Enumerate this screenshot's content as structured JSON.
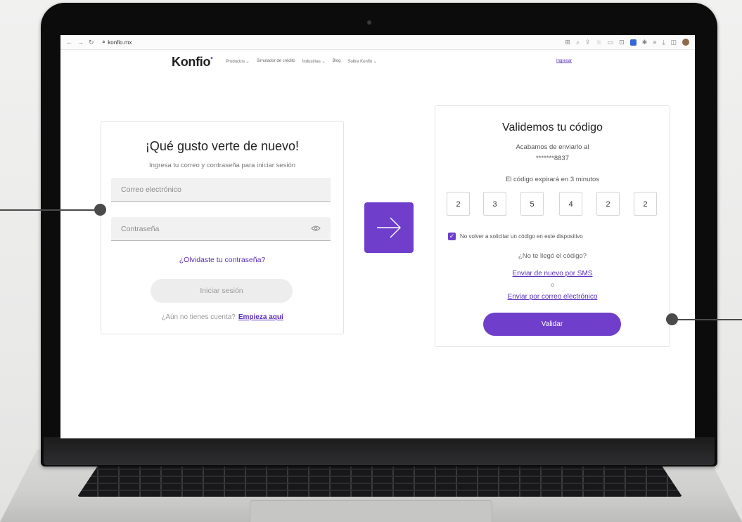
{
  "browser": {
    "url": "konfio.mx"
  },
  "site": {
    "logo": "Konfio",
    "menu": [
      "Productos ⌄",
      "Simulador de crédito",
      "Industrias ⌄",
      "Blog",
      "Sobre Konfio ⌄"
    ],
    "ingresar": "Ingresar"
  },
  "login": {
    "title": "¡Qué gusto verte de nuevo!",
    "subtitle": "Ingresa tu correo y contraseña para iniciar sesión",
    "email_placeholder": "Correo electrónico",
    "password_placeholder": "Contraseña",
    "forgot": "¿Olvidaste tu contraseña?",
    "submit": "Iniciar sesión",
    "no_account": "¿Aún no tienes cuenta?",
    "signup_link": "Empieza aquí"
  },
  "validate": {
    "title": "Validemos tu código",
    "sent_text": "Acabamos de enviarlo al",
    "phone": "*******8837",
    "expire": "El código expirará en 3 minutos",
    "code": [
      "2",
      "3",
      "5",
      "4",
      "2",
      "2"
    ],
    "remember_label": "No volver a solicitar un código en este dispositivo",
    "remember_checked": true,
    "no_code": "¿No te llegó el código?",
    "resend_sms": "Enviar de nuevo por SMS",
    "or": "o",
    "resend_email": "Enviar por correo electrónico",
    "submit": "Validar"
  },
  "colors": {
    "accent": "#6f3fcb",
    "link": "#5a2fb8"
  }
}
